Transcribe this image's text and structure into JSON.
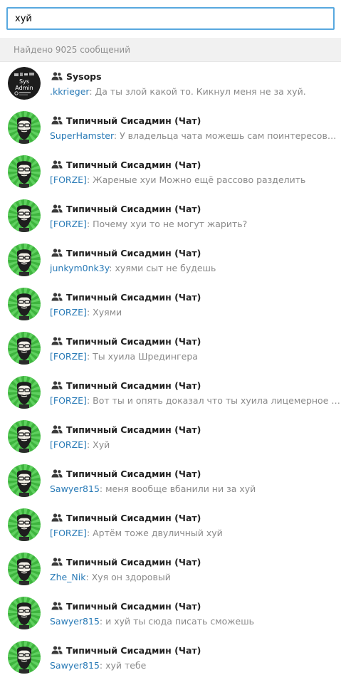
{
  "search": {
    "value": "хуй"
  },
  "results_header": "Найдено 9025 сообщений",
  "colors": {
    "accent": "#58a8df",
    "author": "#2a7bb7",
    "avatar_green": "#3eb43e"
  },
  "results": [
    {
      "chat": "Sysops",
      "author": ".kkrieger",
      "text": "Да ты злой какой  то. Кикнул меня не за хуй.",
      "avatar": "sysadmin-logo",
      "avatar_lines": [
        "Sys",
        "Admin"
      ]
    },
    {
      "chat": "Типичный Сисадмин (Чат)",
      "author": "SuperHamster",
      "text": "У владельца чата можешь сам поинтересоваться. Я не он",
      "avatar": "bearded-admin-face"
    },
    {
      "chat": "Типичный Сисадмин (Чат)",
      "author": "[FORZE]",
      "text": "Жареные хуи Можно ещё рассово разделить",
      "avatar": "bearded-admin-face"
    },
    {
      "chat": "Типичный Сисадмин (Чат)",
      "author": "[FORZE]",
      "text": "Почему хуи то не могут жарить?",
      "avatar": "bearded-admin-face"
    },
    {
      "chat": "Типичный Сисадмин (Чат)",
      "author": "junkym0nk3y",
      "text": "хуями сыт не будешь",
      "avatar": "bearded-admin-face"
    },
    {
      "chat": "Типичный Сисадмин (Чат)",
      "author": "[FORZE]",
      "text": "Хуями",
      "avatar": "bearded-admin-face"
    },
    {
      "chat": "Типичный Сисадмин (Чат)",
      "author": "[FORZE]",
      "text": "Ты хуила Шредингера",
      "avatar": "bearded-admin-face"
    },
    {
      "chat": "Типичный Сисадмин (Чат)",
      "author": "[FORZE]",
      "text": "Вот ты и опять доказал что ты хуила лицемерное тоже",
      "avatar": "bearded-admin-face"
    },
    {
      "chat": "Типичный Сисадмин (Чат)",
      "author": "[FORZE]",
      "text": "Хуй",
      "avatar": "bearded-admin-face"
    },
    {
      "chat": "Типичный Сисадмин (Чат)",
      "author": "Sawyer815",
      "text": "меня вообще вбанили ни за хуй",
      "avatar": "bearded-admin-face"
    },
    {
      "chat": "Типичный Сисадмин (Чат)",
      "author": "[FORZE]",
      "text": "Артём тоже двуличный хуй",
      "avatar": "bearded-admin-face"
    },
    {
      "chat": "Типичный Сисадмин (Чат)",
      "author": "Zhe_Nik",
      "text": "Хуя он здоровый",
      "avatar": "bearded-admin-face"
    },
    {
      "chat": "Типичный Сисадмин (Чат)",
      "author": "Sawyer815",
      "text": "и хуй ты сюда писать сможешь",
      "avatar": "bearded-admin-face"
    },
    {
      "chat": "Типичный Сисадмин (Чат)",
      "author": "Sawyer815",
      "text": "хуй тебе",
      "avatar": "bearded-admin-face"
    }
  ]
}
